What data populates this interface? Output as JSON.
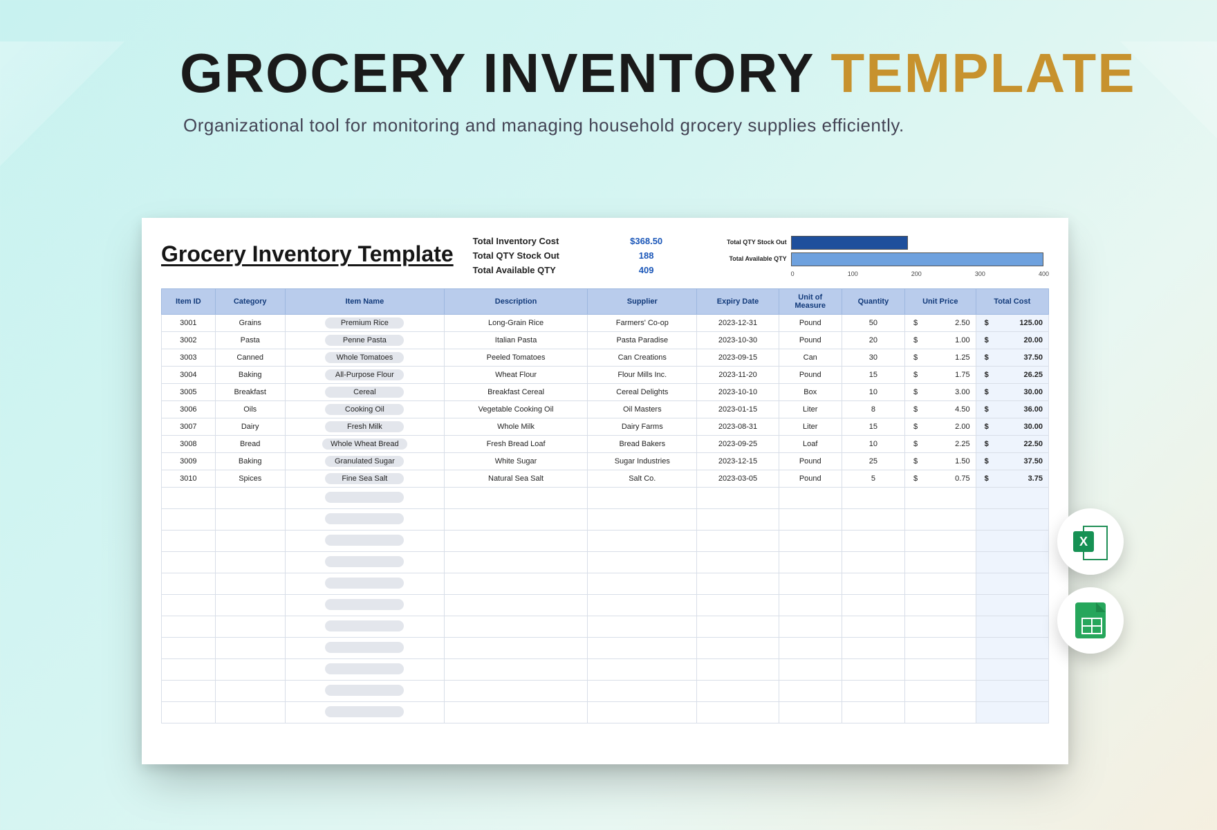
{
  "page": {
    "title_main": "GROCERY INVENTORY ",
    "title_accent": "TEMPLATE",
    "subtitle": "Organizational tool for monitoring and managing household grocery supplies efficiently."
  },
  "sheet": {
    "heading": "Grocery Inventory Template",
    "summary": {
      "labels": [
        "Total Inventory Cost",
        "Total QTY Stock Out",
        "Total Available QTY"
      ],
      "values": [
        "$368.50",
        "188",
        "409"
      ]
    }
  },
  "chart_data": {
    "type": "bar",
    "orientation": "horizontal",
    "categories": [
      "Total QTY Stock Out",
      "Total Available QTY"
    ],
    "values": [
      188,
      409
    ],
    "xlim": [
      0,
      420
    ],
    "ticks": [
      "0",
      "100",
      "200",
      "300",
      "400"
    ]
  },
  "table": {
    "headers": [
      "Item ID",
      "Category",
      "Item Name",
      "Description",
      "Supplier",
      "Expiry Date",
      "Unit of Measure",
      "Quantity",
      "Unit Price",
      "Total Cost"
    ],
    "rows": [
      {
        "id": "3001",
        "category": "Grains",
        "name": "Premium Rice",
        "desc": "Long-Grain Rice",
        "supplier": "Farmers' Co-op",
        "expiry": "2023-12-31",
        "uom": "Pound",
        "qty": "50",
        "price": "2.50",
        "total": "125.00"
      },
      {
        "id": "3002",
        "category": "Pasta",
        "name": "Penne Pasta",
        "desc": "Italian Pasta",
        "supplier": "Pasta Paradise",
        "expiry": "2023-10-30",
        "uom": "Pound",
        "qty": "20",
        "price": "1.00",
        "total": "20.00"
      },
      {
        "id": "3003",
        "category": "Canned",
        "name": "Whole Tomatoes",
        "desc": "Peeled Tomatoes",
        "supplier": "Can Creations",
        "expiry": "2023-09-15",
        "uom": "Can",
        "qty": "30",
        "price": "1.25",
        "total": "37.50"
      },
      {
        "id": "3004",
        "category": "Baking",
        "name": "All-Purpose Flour",
        "desc": "Wheat Flour",
        "supplier": "Flour Mills Inc.",
        "expiry": "2023-11-20",
        "uom": "Pound",
        "qty": "15",
        "price": "1.75",
        "total": "26.25"
      },
      {
        "id": "3005",
        "category": "Breakfast",
        "name": "Cereal",
        "desc": "Breakfast Cereal",
        "supplier": "Cereal Delights",
        "expiry": "2023-10-10",
        "uom": "Box",
        "qty": "10",
        "price": "3.00",
        "total": "30.00"
      },
      {
        "id": "3006",
        "category": "Oils",
        "name": "Cooking Oil",
        "desc": "Vegetable Cooking Oil",
        "supplier": "Oil Masters",
        "expiry": "2023-01-15",
        "uom": "Liter",
        "qty": "8",
        "price": "4.50",
        "total": "36.00"
      },
      {
        "id": "3007",
        "category": "Dairy",
        "name": "Fresh Milk",
        "desc": "Whole Milk",
        "supplier": "Dairy Farms",
        "expiry": "2023-08-31",
        "uom": "Liter",
        "qty": "15",
        "price": "2.00",
        "total": "30.00"
      },
      {
        "id": "3008",
        "category": "Bread",
        "name": "Whole Wheat Bread",
        "desc": "Fresh Bread Loaf",
        "supplier": "Bread Bakers",
        "expiry": "2023-09-25",
        "uom": "Loaf",
        "qty": "10",
        "price": "2.25",
        "total": "22.50"
      },
      {
        "id": "3009",
        "category": "Baking",
        "name": "Granulated Sugar",
        "desc": "White Sugar",
        "supplier": "Sugar Industries",
        "expiry": "2023-12-15",
        "uom": "Pound",
        "qty": "25",
        "price": "1.50",
        "total": "37.50"
      },
      {
        "id": "3010",
        "category": "Spices",
        "name": "Fine Sea Salt",
        "desc": "Natural Sea Salt",
        "supplier": "Salt Co.",
        "expiry": "2023-03-05",
        "uom": "Pound",
        "qty": "5",
        "price": "0.75",
        "total": "3.75"
      }
    ],
    "empty_rows": 11
  },
  "badges": {
    "excel_letter": "X"
  }
}
